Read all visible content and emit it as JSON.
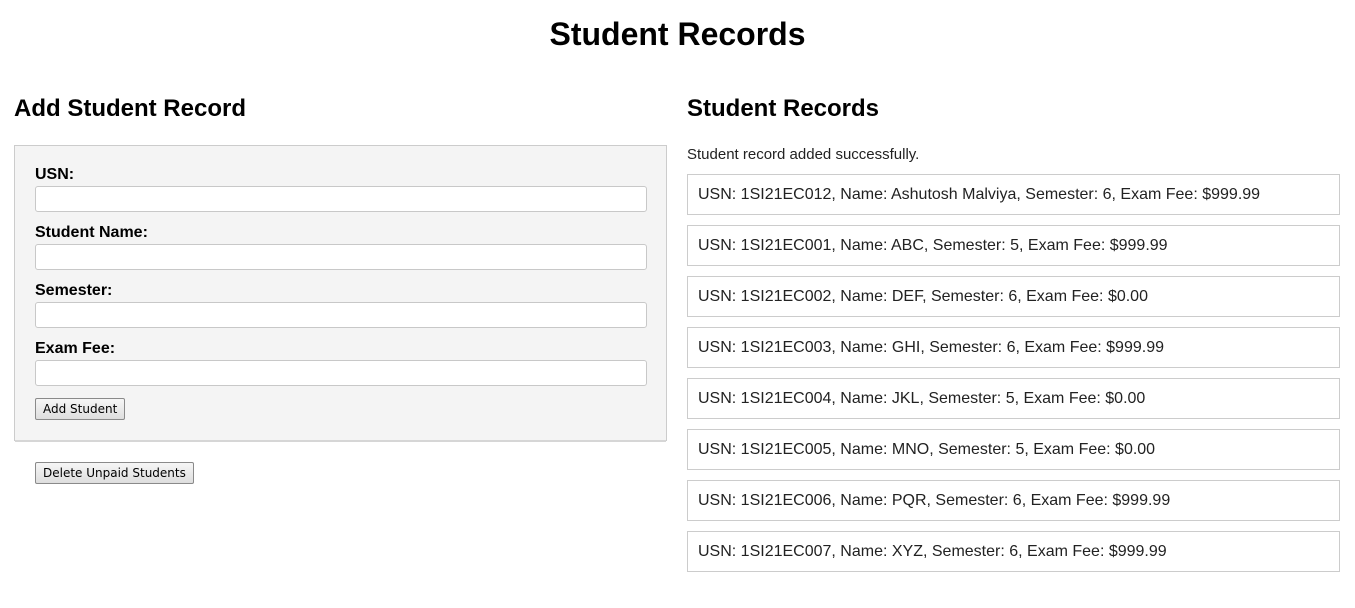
{
  "page": {
    "title": "Student Records"
  },
  "add_form": {
    "heading": "Add Student Record",
    "fields": [
      {
        "label": "USN:",
        "value": "",
        "placeholder": ""
      },
      {
        "label": "Student Name:",
        "value": "",
        "placeholder": ""
      },
      {
        "label": "Semester:",
        "value": "",
        "placeholder": ""
      },
      {
        "label": "Exam Fee:",
        "value": "",
        "placeholder": ""
      }
    ],
    "add_button": "Add Student",
    "delete_button": "Delete Unpaid Students"
  },
  "records": {
    "heading": "Student Records",
    "status": "Student record added successfully.",
    "items": [
      "USN: 1SI21EC012, Name: Ashutosh Malviya, Semester: 6, Exam Fee: $999.99",
      "USN: 1SI21EC001, Name: ABC, Semester: 5, Exam Fee: $999.99",
      "USN: 1SI21EC002, Name: DEF, Semester: 6, Exam Fee: $0.00",
      "USN: 1SI21EC003, Name: GHI, Semester: 6, Exam Fee: $999.99",
      "USN: 1SI21EC004, Name: JKL, Semester: 5, Exam Fee: $0.00",
      "USN: 1SI21EC005, Name: MNO, Semester: 5, Exam Fee: $0.00",
      "USN: 1SI21EC006, Name: PQR, Semester: 6, Exam Fee: $999.99",
      "USN: 1SI21EC007, Name: XYZ, Semester: 6, Exam Fee: $999.99"
    ]
  }
}
